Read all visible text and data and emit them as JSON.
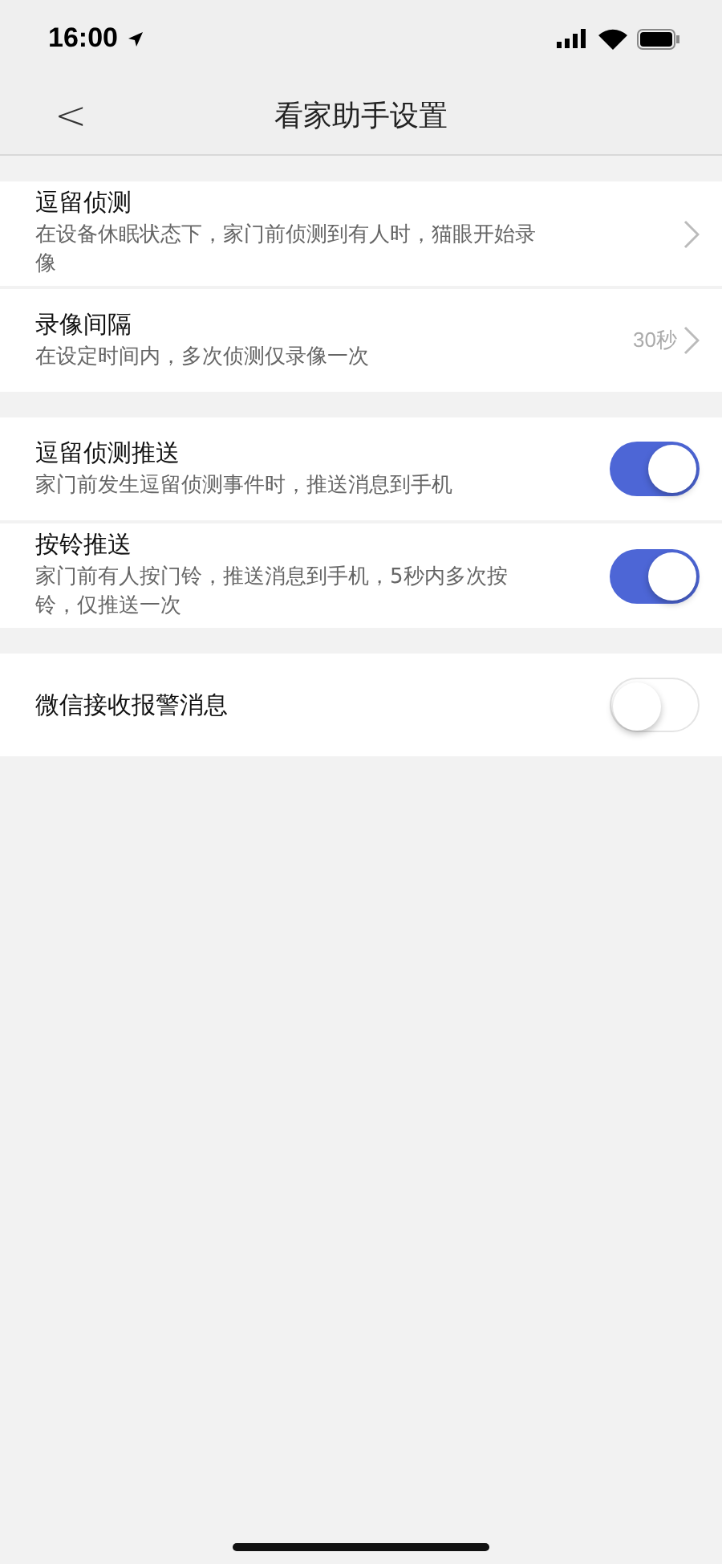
{
  "status_bar": {
    "time": "16:00"
  },
  "nav": {
    "back": "<",
    "title": "看家助手设置"
  },
  "sections": [
    {
      "rows": [
        {
          "kind": "link",
          "title": "逗留侦测",
          "description": "在设备休眠状态下，家门前侦测到有人时，猫眼开始录像"
        },
        {
          "kind": "link",
          "title": "录像间隔",
          "description": "在设定时间内，多次侦测仅录像一次",
          "value": "30秒"
        }
      ]
    },
    {
      "rows": [
        {
          "kind": "toggle",
          "title": "逗留侦测推送",
          "description": "家门前发生逗留侦测事件时，推送消息到手机",
          "on": true
        },
        {
          "kind": "toggle",
          "title": "按铃推送",
          "description": "家门前有人按门铃，推送消息到手机，5秒内多次按铃，仅推送一次",
          "on": true
        }
      ]
    },
    {
      "rows": [
        {
          "kind": "toggle",
          "title": "微信接收报警消息",
          "on": false
        }
      ]
    }
  ]
}
